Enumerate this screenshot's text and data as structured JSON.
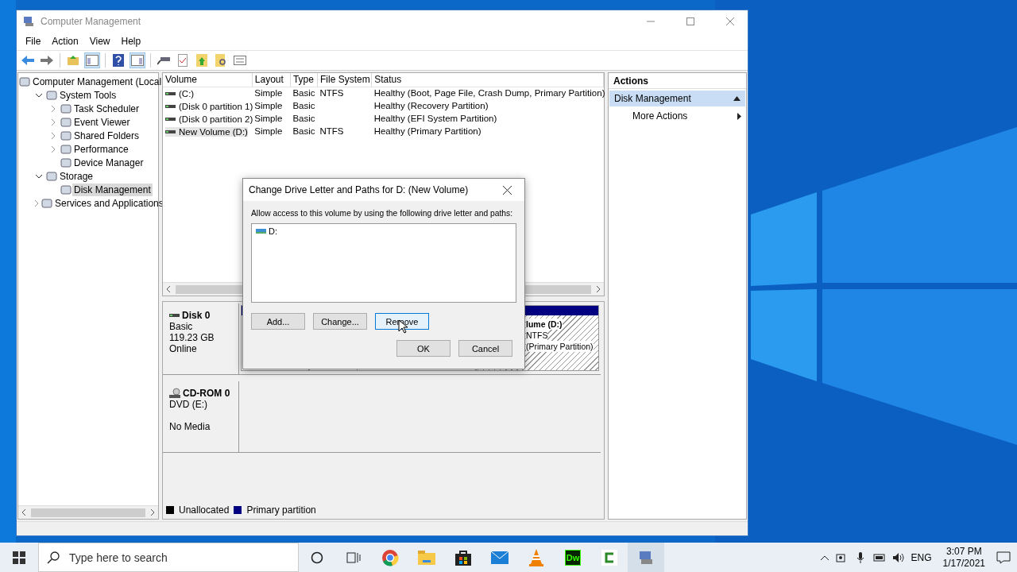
{
  "window": {
    "title": "Computer Management"
  },
  "menu": [
    "File",
    "Action",
    "View",
    "Help"
  ],
  "tree": [
    {
      "label": "Computer Management (Local",
      "selected": false,
      "children": [
        {
          "label": "System Tools",
          "expanded": true,
          "selected": false,
          "children": [
            {
              "label": "Task Scheduler",
              "expanded": false,
              "selected": false
            },
            {
              "label": "Event Viewer",
              "expanded": false,
              "selected": false
            },
            {
              "label": "Shared Folders",
              "expanded": false,
              "selected": false
            },
            {
              "label": "Performance",
              "expanded": false,
              "selected": false
            },
            {
              "label": "Device Manager",
              "selected": false
            }
          ]
        },
        {
          "label": "Storage",
          "expanded": true,
          "selected": false,
          "children": [
            {
              "label": "Disk Management",
              "selected": true
            }
          ]
        },
        {
          "label": "Services and Applications",
          "expanded": false,
          "selected": false
        }
      ]
    }
  ],
  "volume_table": {
    "columns": [
      "Volume",
      "Layout",
      "Type",
      "File System",
      "Status"
    ],
    "rows": [
      {
        "cells": [
          " (C:)",
          "Simple",
          "Basic",
          "NTFS",
          "Healthy (Boot, Page File, Crash Dump, Primary Partition)"
        ],
        "selected": false
      },
      {
        "cells": [
          "(Disk 0 partition 1)",
          "Simple",
          "Basic",
          "",
          "Healthy (Recovery Partition)"
        ],
        "selected": false
      },
      {
        "cells": [
          "(Disk 0 partition 2)",
          "Simple",
          "Basic",
          "",
          "Healthy (EFI System Partition)"
        ],
        "selected": false
      },
      {
        "cells": [
          "New Volume (D:)",
          "Simple",
          "Basic",
          "NTFS",
          "Healthy (Primary Partition)"
        ],
        "selected": true
      }
    ]
  },
  "disks": [
    {
      "name": "Disk 0",
      "lines": [
        "Basic",
        "119.23 GB",
        "Online"
      ],
      "partition_lines": [
        "lume  (D:)",
        "NTFS",
        "(Primary Partition)"
      ]
    },
    {
      "name": "CD-ROM 0",
      "lines": [
        "DVD (E:)",
        "No Media"
      ]
    }
  ],
  "legend": [
    {
      "label": "Unallocated",
      "color": "#000000"
    },
    {
      "label": "Primary partition",
      "color": "#000080"
    }
  ],
  "actions": {
    "title": "Actions",
    "items": [
      {
        "label": "Disk Management",
        "kind": "section",
        "expanded": true
      },
      {
        "label": "More Actions",
        "kind": "submenu"
      }
    ]
  },
  "dialog": {
    "title": "Change Drive Letter and Paths for D: (New Volume)",
    "instruction": "Allow access to this volume by using the following drive letter and paths:",
    "paths": [
      "D:"
    ],
    "buttons": [
      {
        "label": "Add...",
        "hovered": false
      },
      {
        "label": "Change...",
        "hovered": false
      },
      {
        "label": "Remove",
        "hovered": true
      }
    ],
    "footer_buttons": [
      "OK",
      "Cancel"
    ]
  },
  "taskbar": {
    "search_placeholder": "Type here to search",
    "app_icon_text": "Dw",
    "language": "ENG",
    "time": "3:07 PM",
    "date": "1/17/2021"
  }
}
